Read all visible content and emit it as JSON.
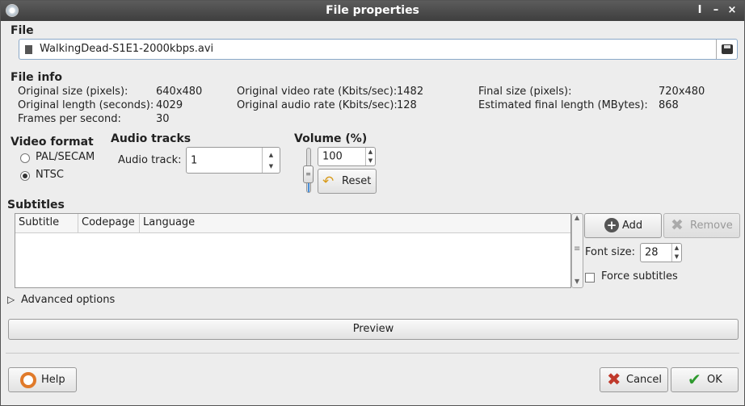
{
  "window": {
    "title": "File properties",
    "controls": {
      "shade": "I",
      "minimize": "–",
      "close": "×"
    }
  },
  "file": {
    "section_label": "File",
    "filename": "WalkingDead-S1E1-2000kbps.avi"
  },
  "file_info": {
    "section_label": "File info",
    "col1": [
      {
        "label": "Original size (pixels):",
        "value": "640x480"
      },
      {
        "label": "Original length (seconds):",
        "value": "4029"
      },
      {
        "label": "Frames per second:",
        "value": "30"
      }
    ],
    "col2": [
      {
        "label": "Original video rate (Kbits/sec):",
        "value": "1482"
      },
      {
        "label": "Original audio rate (Kbits/sec):",
        "value": "128"
      }
    ],
    "col3": [
      {
        "label": "Final size (pixels):",
        "value": "720x480"
      },
      {
        "label": "Estimated final length (MBytes):",
        "value": "868"
      }
    ]
  },
  "video_format": {
    "section_label": "Video format",
    "options": [
      "PAL/SECAM",
      "NTSC"
    ],
    "selected": "NTSC"
  },
  "audio_tracks": {
    "section_label": "Audio tracks",
    "track_label": "Audio track:",
    "track_value": "1"
  },
  "volume": {
    "section_label": "Volume (%)",
    "value": "100",
    "reset_label": "Reset"
  },
  "subtitles": {
    "section_label": "Subtitles",
    "columns": [
      "Subtitle",
      "Codepage",
      "Language"
    ],
    "rows": [],
    "add_label": "Add",
    "remove_label": "Remove",
    "font_size_label": "Font size:",
    "font_size_value": "28",
    "force_label": "Force subtitles",
    "force_checked": false
  },
  "advanced": {
    "label": "Advanced options",
    "expanded": false
  },
  "preview_label": "Preview",
  "footer": {
    "help_label": "Help",
    "cancel_label": "Cancel",
    "ok_label": "OK"
  },
  "colors": {
    "titlebar": "#4a4a4a",
    "slider_fill": "#4a8fd8",
    "cancel_icon": "#c0392b",
    "ok_icon": "#2e9a2e"
  }
}
